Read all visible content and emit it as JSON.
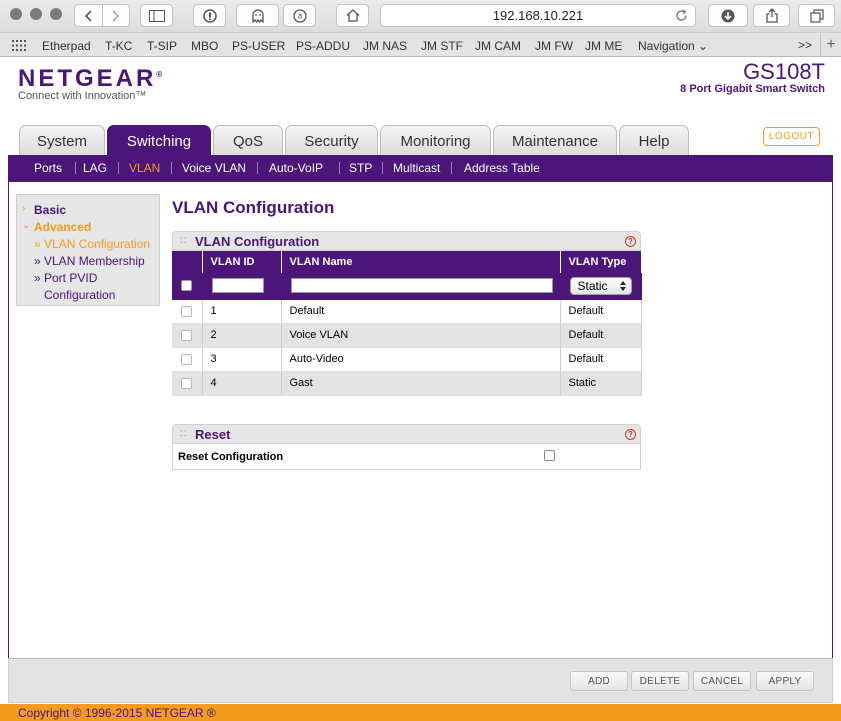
{
  "browser": {
    "url": "192.168.10.221",
    "bookmarks": [
      "Etherpad",
      "T-KC",
      "T-SIP",
      "MBO",
      "PS-USER",
      "PS-ADDU",
      "JM NAS",
      "JM STF",
      "JM CAM",
      "JM FW",
      "JM ME",
      "Navigation ⌄"
    ],
    "more": ">>",
    "plus": "+"
  },
  "header": {
    "logo": "NETGEAR",
    "logo_mark": "®",
    "tagline": "Connect with Innovation™",
    "model": "GS108T",
    "model_desc": "8 Port Gigabit Smart Switch",
    "logout": "LOGOUT"
  },
  "tabs": [
    {
      "label": "System"
    },
    {
      "label": "Switching"
    },
    {
      "label": "QoS"
    },
    {
      "label": "Security"
    },
    {
      "label": "Monitoring"
    },
    {
      "label": "Maintenance"
    },
    {
      "label": "Help"
    }
  ],
  "subnav": [
    "Ports",
    "LAG",
    "VLAN",
    "Voice VLAN",
    "Auto-VoIP",
    "STP",
    "Multicast",
    "Address Table"
  ],
  "sidebar": {
    "basic": "Basic",
    "advanced": "Advanced",
    "items": [
      "» VLAN Configuration",
      "» VLAN Membership",
      "» Port PVID",
      "Configuration"
    ]
  },
  "main": {
    "title": "VLAN Configuration",
    "panel_title": "VLAN Configuration",
    "dots": "::",
    "help": "?",
    "columns": [
      "VLAN ID",
      "VLAN Name",
      "VLAN Type"
    ],
    "type_select": "Static",
    "rows": [
      {
        "id": "1",
        "name": "Default",
        "type": "Default"
      },
      {
        "id": "2",
        "name": "Voice VLAN",
        "type": "Default"
      },
      {
        "id": "3",
        "name": "Auto-Video",
        "type": "Default"
      },
      {
        "id": "4",
        "name": "Gast",
        "type": "Static"
      }
    ],
    "reset_title": "Reset",
    "reset_label": "Reset Configuration"
  },
  "buttons": [
    "ADD",
    "DELETE",
    "CANCEL",
    "APPLY"
  ],
  "footer": "Copyright © 1996-2015 NETGEAR ®",
  "colors": {
    "brand_purple": "#4b1579",
    "accent_orange": "#f39c1f"
  }
}
